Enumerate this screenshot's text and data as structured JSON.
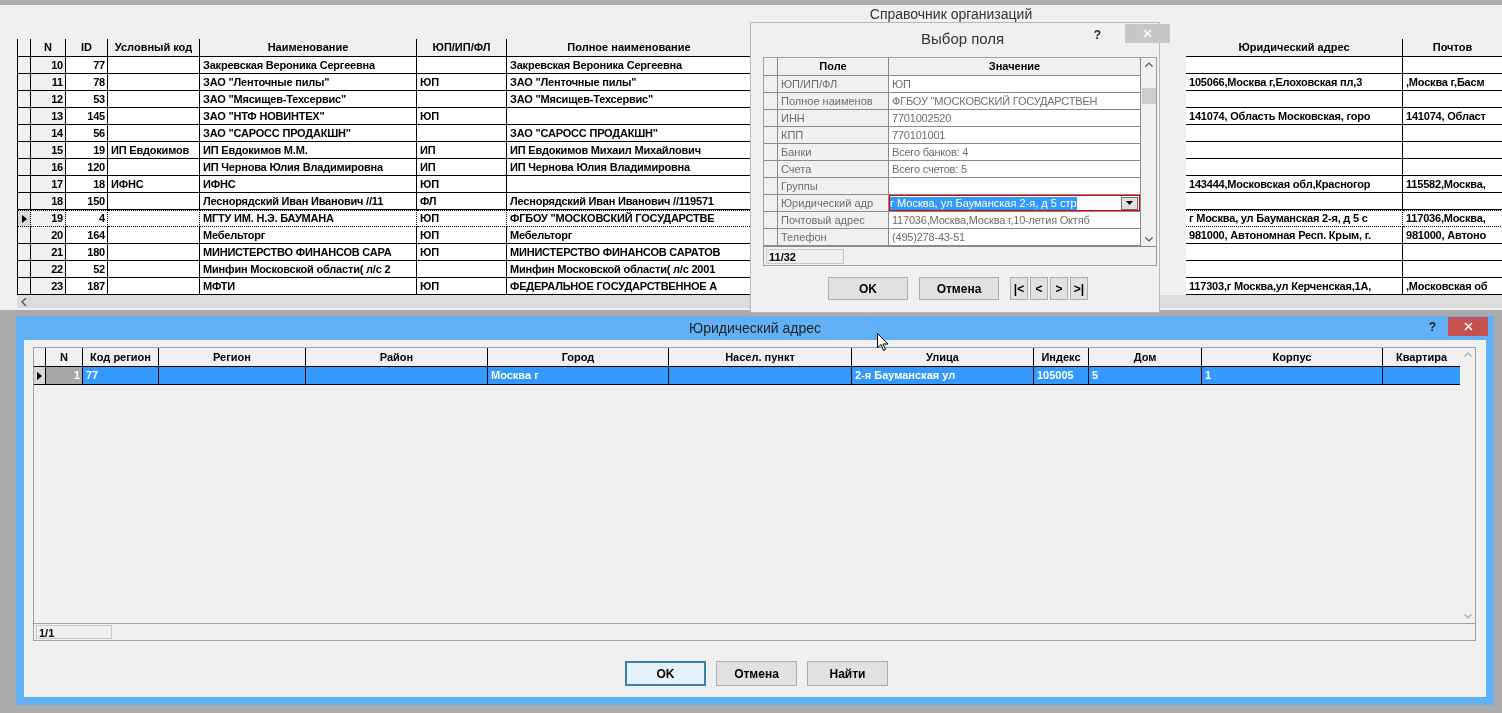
{
  "main_window": {
    "title": "Справочник организаций"
  },
  "org_table": {
    "columns": [
      "N",
      "ID",
      "Условный код",
      "Наименование",
      "ЮП/ИП/ФЛ",
      "Полное наименование",
      "Юридический адрес",
      "Почтов"
    ],
    "rows": [
      {
        "selected": false,
        "cells": [
          "10",
          "77",
          null,
          "Закревская Вероника Сергеевна",
          null,
          "Закревская Вероника Сергеевна",
          null,
          null
        ]
      },
      {
        "selected": false,
        "cells": [
          "11",
          "78",
          null,
          "ЗАО \"Ленточные пилы\"",
          "ЮП",
          "ЗАО \"Ленточные пилы\"",
          "105066,Москва г,Елоховская пл,3",
          ",Москва г,Басм"
        ]
      },
      {
        "selected": false,
        "cells": [
          "12",
          "53",
          null,
          "ЗАО \"Мясищев-Техсервис\"",
          null,
          "ЗАО \"Мясищев-Техсервис\"",
          null,
          null
        ]
      },
      {
        "selected": false,
        "cells": [
          "13",
          "145",
          null,
          "ЗАО \"НТФ НОВИНТЕХ\"",
          "ЮП",
          null,
          "141074, Область Московская, горо",
          "141074, Област"
        ]
      },
      {
        "selected": false,
        "cells": [
          "14",
          "56",
          null,
          "ЗАО \"САРОСС ПРОДАКШН\"",
          null,
          "ЗАО \"САРОСС ПРОДАКШН\"",
          null,
          null
        ]
      },
      {
        "selected": false,
        "cells": [
          "15",
          "19",
          "ИП Евдокимов",
          "ИП Евдокимов М.М.",
          "ИП",
          "ИП Евдокимов Михаил Михайлович",
          null,
          null
        ]
      },
      {
        "selected": false,
        "cells": [
          "16",
          "120",
          null,
          "ИП Чернова Юлия Владимировна",
          "ИП",
          "ИП Чернова Юлия Владимировна",
          null,
          null
        ]
      },
      {
        "selected": false,
        "cells": [
          "17",
          "18",
          "ИФНС",
          "ИФНС",
          "ЮП",
          null,
          "143444,Московская обл,Красногор",
          "115582,Москва,"
        ]
      },
      {
        "selected": false,
        "cells": [
          "18",
          "150",
          null,
          "Леснорядский Иван Иванович //11",
          "ФЛ",
          "Леснорядский Иван Иванович //119571",
          null,
          null
        ]
      },
      {
        "selected": true,
        "cells": [
          "19",
          "4",
          null,
          "МГТУ ИМ. Н.Э. БАУМАНА",
          "ЮП",
          "ФГБОУ \"МОСКОВСКИЙ ГОСУДАРСТВЕ",
          "г Москва, ул Бауманская 2-я, д 5 с",
          "117036,Москва,"
        ]
      },
      {
        "selected": false,
        "cells": [
          "20",
          "164",
          null,
          "Мебельторг",
          "ЮП",
          "Мебельторг",
          "981000, Автономная Респ. Крым, г.",
          "981000, Автоно"
        ]
      },
      {
        "selected": false,
        "cells": [
          "21",
          "180",
          null,
          "МИНИСТЕРСТВО ФИНАНСОВ САРА",
          "ЮП",
          "МИНИСТЕРСТВО ФИНАНСОВ САРАТОВ",
          null,
          null
        ]
      },
      {
        "selected": false,
        "cells": [
          "22",
          "52",
          null,
          "Минфин Московской области( л/с 2",
          null,
          "Минфин Московской области( л/с 2001",
          null,
          null
        ]
      },
      {
        "selected": false,
        "cells": [
          "23",
          "187",
          null,
          "МФТИ",
          "ЮП",
          "ФЕДЕРАЛЬНОЕ ГОСУДАРСТВЕННОЕ А",
          "117303,г Москва,ул Керченская,1А,",
          ",Московская об"
        ]
      }
    ]
  },
  "field_dialog": {
    "title": "Выбор поля",
    "help": "?",
    "columns": [
      "Поле",
      "Значение"
    ],
    "rows": [
      {
        "field": "ЮП/ИП/ФЛ",
        "value": "ЮП",
        "editing": false
      },
      {
        "field": "Полное наименов",
        "value": "ФГБОУ \"МОСКОВСКИЙ ГОСУДАРСТВЕН",
        "editing": false
      },
      {
        "field": "ИНН",
        "value": "7701002520",
        "editing": false
      },
      {
        "field": "КПП",
        "value": "770101001",
        "editing": false
      },
      {
        "field": "Банки",
        "value": "Всего банков: 4",
        "editing": false
      },
      {
        "field": "Счета",
        "value": "Всего счетов: 5",
        "editing": false
      },
      {
        "field": "Группы",
        "editing": false
      },
      {
        "field": "Юридический адр",
        "value": "г Москва, ул Бауманская 2-я, д 5 стр",
        "editing": true
      },
      {
        "field": "Почтовый адрес",
        "value": "117036,Москва,Москва г,10-летия Октяб",
        "editing": false
      },
      {
        "field": "Телефон",
        "value": "(495)278-43-51",
        "editing": false
      }
    ],
    "counter": "11/32",
    "buttons": [
      {
        "label": "OK",
        "default": false
      },
      {
        "label": "Отмена",
        "default": false
      }
    ],
    "nav_buttons": [
      "|<",
      "<",
      ">",
      ">|"
    ]
  },
  "address_dialog": {
    "title": "Юридический адрес",
    "help": "?",
    "columns": [
      "N",
      "Код регион",
      "Регион",
      "Район",
      "Город",
      "Насел. пункт",
      "Улица",
      "Индекс",
      "Дом",
      "Корпус",
      "Квартира"
    ],
    "rows": [
      {
        "selected": true,
        "cells": [
          "1",
          "77",
          null,
          null,
          "Москва г",
          null,
          "2-я Бауманская ул",
          "105005",
          "5",
          "1",
          null
        ]
      }
    ],
    "counter": "1/1",
    "buttons": [
      {
        "label": "OK",
        "default": true
      },
      {
        "label": "Отмена",
        "default": false
      },
      {
        "label": "Найти",
        "default": false
      }
    ]
  }
}
